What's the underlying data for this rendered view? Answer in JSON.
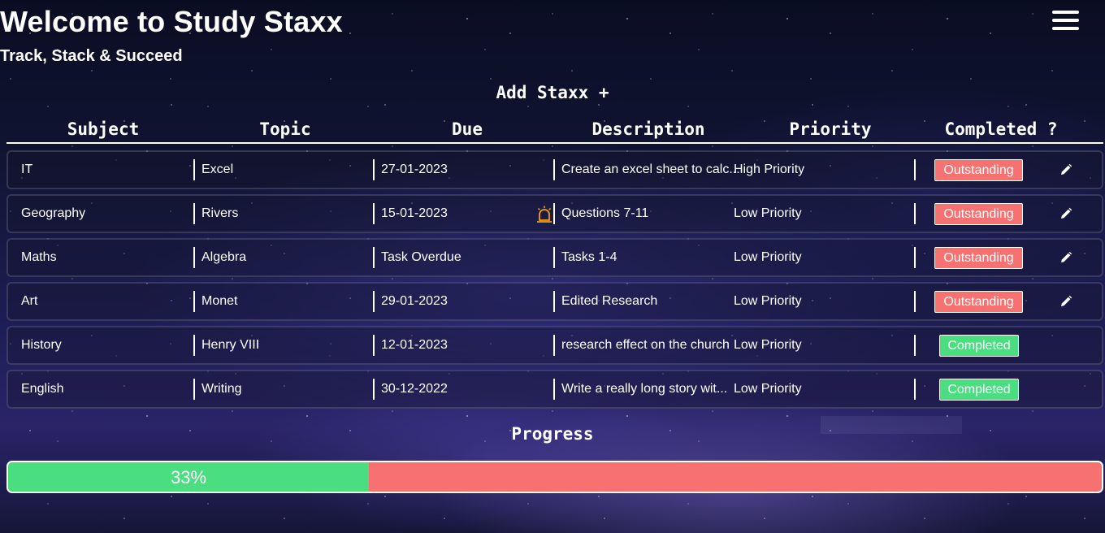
{
  "header": {
    "title": "Welcome to Study Staxx",
    "subtitle": "Track, Stack & Succeed",
    "add_label": "Add Staxx +",
    "menu_icon": "hamburger-menu-icon"
  },
  "table": {
    "columns": [
      "Subject",
      "Topic",
      "Due",
      "Description",
      "Priority",
      "Completed ?"
    ],
    "rows": [
      {
        "subject": "IT",
        "topic": "Excel",
        "due": "27-01-2023",
        "description": "Create an excel sheet to calc...",
        "priority": "High Priority",
        "status": "Outstanding",
        "alarm": false,
        "editable": true
      },
      {
        "subject": "Geography",
        "topic": "Rivers",
        "due": "15-01-2023",
        "description": "Questions 7-11",
        "priority": "Low Priority",
        "status": "Outstanding",
        "alarm": true,
        "editable": true
      },
      {
        "subject": "Maths",
        "topic": "Algebra",
        "due": "Task Overdue",
        "description": "Tasks 1-4",
        "priority": "Low Priority",
        "status": "Outstanding",
        "alarm": false,
        "editable": true
      },
      {
        "subject": "Art",
        "topic": "Monet",
        "due": "29-01-2023",
        "description": "Edited Research",
        "priority": "Low Priority",
        "status": "Outstanding",
        "alarm": false,
        "editable": true
      },
      {
        "subject": "History",
        "topic": "Henry VIII",
        "due": "12-01-2023",
        "description": "research effect on the church",
        "priority": "Low Priority",
        "status": "Completed",
        "alarm": false,
        "editable": false
      },
      {
        "subject": "English",
        "topic": "Writing",
        "due": "30-12-2022",
        "description": "Write a really long story wit...",
        "priority": "Low Priority",
        "status": "Completed",
        "alarm": false,
        "editable": false
      }
    ]
  },
  "progress": {
    "title": "Progress",
    "label": "33%",
    "fraction": 0.33
  },
  "colors": {
    "outstanding": "#f87171",
    "completed": "#4ade80",
    "alarm": "#f59e0b"
  }
}
